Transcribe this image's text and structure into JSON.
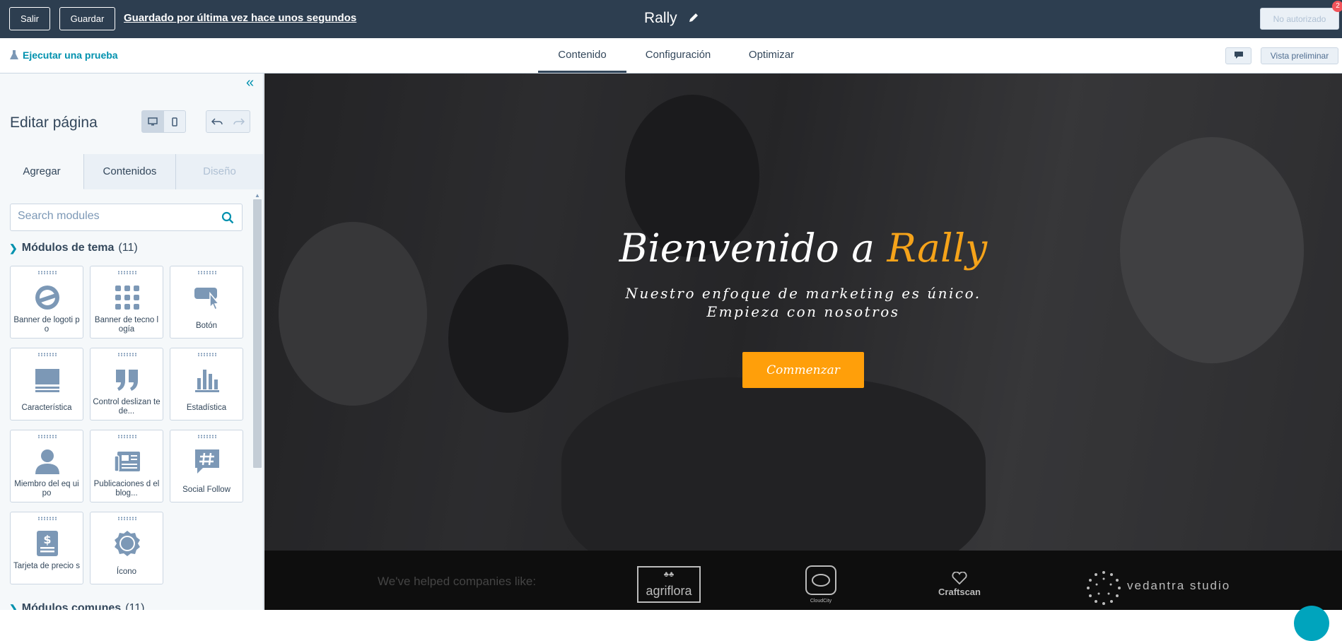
{
  "topbar": {
    "exit_label": "Salir",
    "save_label": "Guardar",
    "last_saved": "Guardado por última vez hace unos segundos",
    "page_name": "Rally",
    "unauthorized_label": "No autorizado",
    "notification_count": "2"
  },
  "subbar": {
    "run_test_label": "Ejecutar una prueba",
    "tabs": [
      {
        "label": "Contenido",
        "active": true
      },
      {
        "label": "Configuración",
        "active": false
      },
      {
        "label": "Optimizar",
        "active": false
      }
    ],
    "preview_label": "Vista preliminar"
  },
  "sidebar": {
    "title": "Editar página",
    "tabs": [
      {
        "label": "Agregar",
        "active": true
      },
      {
        "label": "Contenidos",
        "active": false
      },
      {
        "label": "Diseño",
        "active": false
      }
    ],
    "search": {
      "placeholder": "Search modules",
      "value": ""
    },
    "group": {
      "title": "Módulos de tema",
      "count": "(11)"
    },
    "group2": {
      "title": "Módulos comunes",
      "count": "(11)"
    },
    "modules": [
      {
        "label": "Banner de logoti po",
        "icon": "logo-banner-icon"
      },
      {
        "label": "Banner de tecno logía",
        "icon": "grid-icon"
      },
      {
        "label": "Botón",
        "icon": "button-click-icon"
      },
      {
        "label": "Característica",
        "icon": "feature-icon"
      },
      {
        "label": "Control deslizan te de...",
        "icon": "quote-icon"
      },
      {
        "label": "Estadística",
        "icon": "bar-chart-icon"
      },
      {
        "label": "Miembro del eq uipo",
        "icon": "person-icon"
      },
      {
        "label": "Publicaciones d el blog...",
        "icon": "blog-icon"
      },
      {
        "label": "Social Follow",
        "icon": "hashtag-icon"
      },
      {
        "label": "Tarjeta de precio s",
        "icon": "price-card-icon"
      },
      {
        "label": "Ícono",
        "icon": "badge-icon"
      }
    ]
  },
  "canvas": {
    "hero_title_part1": "Bienvenido a ",
    "hero_title_accent": "Rally",
    "hero_sub_line1": "Nuestro enfoque de marketing es único.",
    "hero_sub_line2": "Empieza con nosotros",
    "cta_label": "Commenzar",
    "accent_color": "#f5a31a",
    "cta_color": "#ff9f0a",
    "logos_caption": "We've helped companies like:",
    "logos": {
      "agriflora": "agriflora",
      "cloudcity": "CloudCity",
      "craftscan": "Craftscan",
      "vedantra": "vedantra studio"
    }
  }
}
